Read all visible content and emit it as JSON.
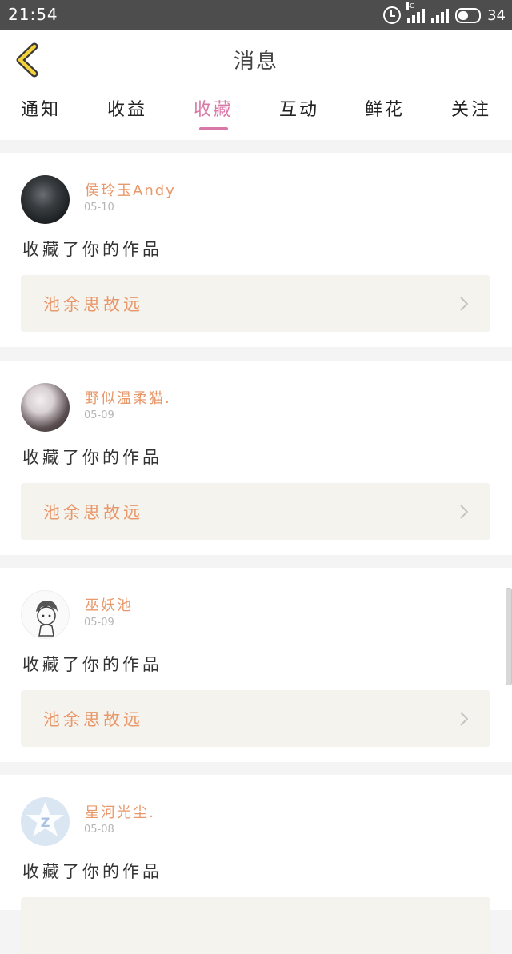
{
  "status_bar": {
    "time": "21:54",
    "network": "4G",
    "battery": "34"
  },
  "header": {
    "title": "消息",
    "back_icon": "chevron-left-icon"
  },
  "tabs": [
    {
      "label": "通知",
      "active": false
    },
    {
      "label": "收益",
      "active": false
    },
    {
      "label": "收藏",
      "active": true
    },
    {
      "label": "互动",
      "active": false
    },
    {
      "label": "鲜花",
      "active": false
    },
    {
      "label": "关注",
      "active": false
    }
  ],
  "messages": [
    {
      "user": "侯玲玉Andy",
      "date": "05-10",
      "action": "收藏了你的作品",
      "work": "池余思故远"
    },
    {
      "user": "野似温柔猫.",
      "date": "05-09",
      "action": "收藏了你的作品",
      "work": "池余思故远"
    },
    {
      "user": "巫妖池",
      "date": "05-09",
      "action": "收藏了你的作品",
      "work": "池余思故远"
    },
    {
      "user": "星河光尘.",
      "date": "05-08",
      "action": "收藏了你的作品",
      "work": ""
    }
  ],
  "colors": {
    "accent": "#d978a6",
    "name_color": "#e8986a",
    "status_bar": "#4d4d4d"
  }
}
